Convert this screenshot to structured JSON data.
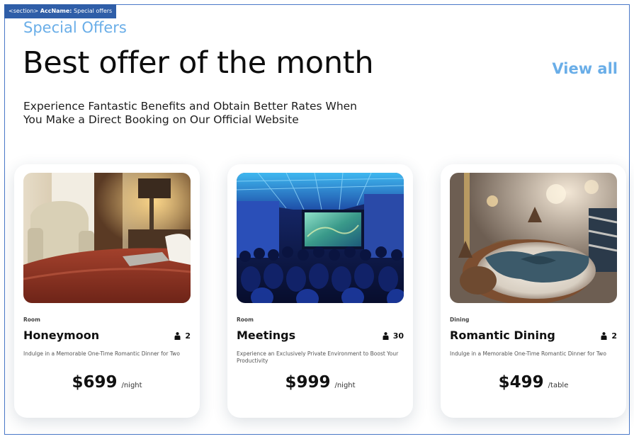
{
  "a11y_tag": {
    "prefix": "<section>",
    "label": "AccName:",
    "value": "Special offers"
  },
  "section": {
    "eyebrow": "Special Offers",
    "headline": "Best offer of the month",
    "view_all": "View all",
    "subtitle": "Experience Fantastic Benefits and Obtain Better Rates When You Make a Direct Booking on Our Official Website"
  },
  "colors": {
    "accent": "#6aaee8",
    "frame": "#4a78c8",
    "tag_bg": "#2f5ea8"
  },
  "cards": [
    {
      "category": "Room",
      "title": "Honeymoon",
      "guests_icon": "person-icon",
      "guests": "2",
      "description": "Indulge in a Memorable One-Time Romantic Dinner for Two",
      "price": "$699",
      "unit": "/night",
      "image": "hotel-room-photo"
    },
    {
      "category": "Room",
      "title": "Meetings",
      "guests_icon": "person-icon",
      "guests": "30",
      "description": "Experience an Exclusively Private Environment to Boost Your Productivity",
      "price": "$999",
      "unit": "/night",
      "image": "conference-hall-photo"
    },
    {
      "category": "Dining",
      "title": "Romantic Dining",
      "guests_icon": "person-icon",
      "guests": "2",
      "description": "Indulge in a Memorable One-Time Romantic Dinner for Two",
      "price": "$499",
      "unit": "/table",
      "image": "dining-table-photo"
    }
  ]
}
